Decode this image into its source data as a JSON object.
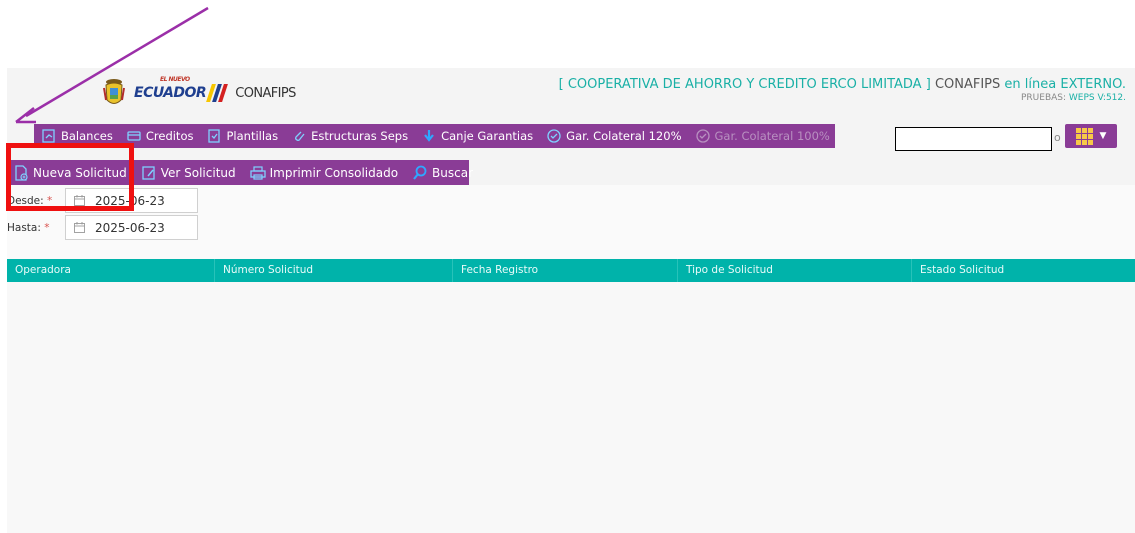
{
  "header": {
    "logo_small": "EL NUEVO",
    "logo_ecuador": "ECUADOR",
    "logo_conafips": "CONAFIPS",
    "coop_name": "[ COOPERATIVA DE AHORRO Y CREDITO ERCO LIMITADA ]",
    "app_prefix": "CONAFIPS",
    "app_suffix": "en línea EXTERNO.",
    "env_label": "PRUEBAS:",
    "env_version": "WEPS V:512."
  },
  "main_menu": {
    "items": [
      {
        "label": "Balances",
        "icon": "balance-sheet-icon"
      },
      {
        "label": "Creditos",
        "icon": "credit-card-icon"
      },
      {
        "label": "Plantillas",
        "icon": "template-icon"
      },
      {
        "label": "Estructuras Seps",
        "icon": "paperclip-icon"
      },
      {
        "label": "Canje Garantias",
        "icon": "arrow-down-icon"
      },
      {
        "label": "Gar. Colateral 120%",
        "icon": "check-circle-icon"
      },
      {
        "label": "Gar. Colateral 100%",
        "icon": "check-circle-icon"
      }
    ]
  },
  "search": {
    "value": "",
    "suffix": "o"
  },
  "toolbar": {
    "items": [
      {
        "label": "Nueva Solicitud",
        "icon": "new-document-icon"
      },
      {
        "label": "Ver Solicitud",
        "icon": "view-document-icon"
      },
      {
        "label": "Imprimir Consolidado",
        "icon": "printer-icon"
      },
      {
        "label": "Buscar",
        "icon": "search-icon"
      }
    ]
  },
  "form": {
    "desde_label": "Desde:",
    "hasta_label": "Hasta:",
    "required_mark": "*",
    "desde_value": "2025-06-23",
    "hasta_value": "2025-06-23"
  },
  "table": {
    "columns": [
      "Operadora",
      "Número Solicitud",
      "Fecha Registro",
      "Tipo de Solicitud",
      "Estado Solicitud"
    ],
    "rows": []
  },
  "colors": {
    "menu_purple": "#8a3c96",
    "teal": "#00b3aa",
    "annotation_red": "#ef1010",
    "annotation_arrow": "#9b2fa8"
  }
}
